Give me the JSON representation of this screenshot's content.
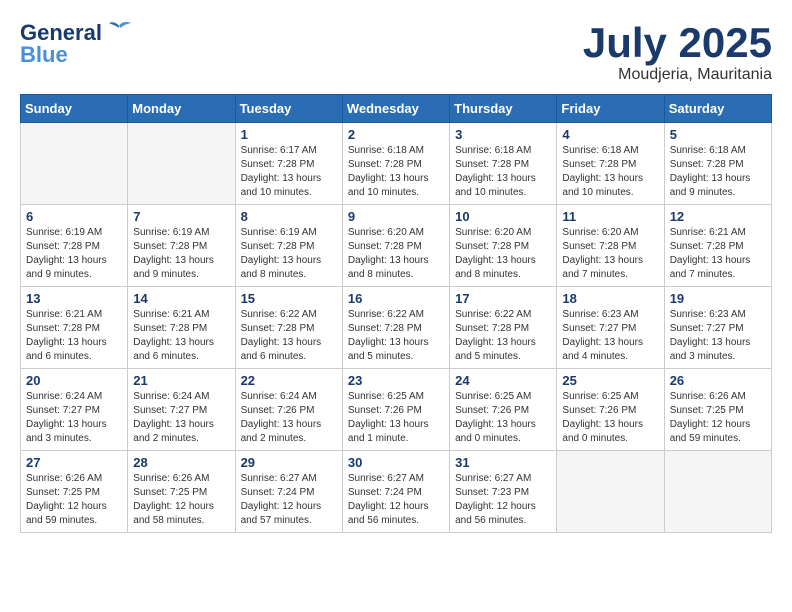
{
  "header": {
    "logo_general": "General",
    "logo_blue": "Blue",
    "month": "July 2025",
    "location": "Moudjeria, Mauritania"
  },
  "weekdays": [
    "Sunday",
    "Monday",
    "Tuesday",
    "Wednesday",
    "Thursday",
    "Friday",
    "Saturday"
  ],
  "weeks": [
    [
      {
        "day": "",
        "info": ""
      },
      {
        "day": "",
        "info": ""
      },
      {
        "day": "1",
        "info": "Sunrise: 6:17 AM\nSunset: 7:28 PM\nDaylight: 13 hours and 10 minutes."
      },
      {
        "day": "2",
        "info": "Sunrise: 6:18 AM\nSunset: 7:28 PM\nDaylight: 13 hours and 10 minutes."
      },
      {
        "day": "3",
        "info": "Sunrise: 6:18 AM\nSunset: 7:28 PM\nDaylight: 13 hours and 10 minutes."
      },
      {
        "day": "4",
        "info": "Sunrise: 6:18 AM\nSunset: 7:28 PM\nDaylight: 13 hours and 10 minutes."
      },
      {
        "day": "5",
        "info": "Sunrise: 6:18 AM\nSunset: 7:28 PM\nDaylight: 13 hours and 9 minutes."
      }
    ],
    [
      {
        "day": "6",
        "info": "Sunrise: 6:19 AM\nSunset: 7:28 PM\nDaylight: 13 hours and 9 minutes."
      },
      {
        "day": "7",
        "info": "Sunrise: 6:19 AM\nSunset: 7:28 PM\nDaylight: 13 hours and 9 minutes."
      },
      {
        "day": "8",
        "info": "Sunrise: 6:19 AM\nSunset: 7:28 PM\nDaylight: 13 hours and 8 minutes."
      },
      {
        "day": "9",
        "info": "Sunrise: 6:20 AM\nSunset: 7:28 PM\nDaylight: 13 hours and 8 minutes."
      },
      {
        "day": "10",
        "info": "Sunrise: 6:20 AM\nSunset: 7:28 PM\nDaylight: 13 hours and 8 minutes."
      },
      {
        "day": "11",
        "info": "Sunrise: 6:20 AM\nSunset: 7:28 PM\nDaylight: 13 hours and 7 minutes."
      },
      {
        "day": "12",
        "info": "Sunrise: 6:21 AM\nSunset: 7:28 PM\nDaylight: 13 hours and 7 minutes."
      }
    ],
    [
      {
        "day": "13",
        "info": "Sunrise: 6:21 AM\nSunset: 7:28 PM\nDaylight: 13 hours and 6 minutes."
      },
      {
        "day": "14",
        "info": "Sunrise: 6:21 AM\nSunset: 7:28 PM\nDaylight: 13 hours and 6 minutes."
      },
      {
        "day": "15",
        "info": "Sunrise: 6:22 AM\nSunset: 7:28 PM\nDaylight: 13 hours and 6 minutes."
      },
      {
        "day": "16",
        "info": "Sunrise: 6:22 AM\nSunset: 7:28 PM\nDaylight: 13 hours and 5 minutes."
      },
      {
        "day": "17",
        "info": "Sunrise: 6:22 AM\nSunset: 7:28 PM\nDaylight: 13 hours and 5 minutes."
      },
      {
        "day": "18",
        "info": "Sunrise: 6:23 AM\nSunset: 7:27 PM\nDaylight: 13 hours and 4 minutes."
      },
      {
        "day": "19",
        "info": "Sunrise: 6:23 AM\nSunset: 7:27 PM\nDaylight: 13 hours and 3 minutes."
      }
    ],
    [
      {
        "day": "20",
        "info": "Sunrise: 6:24 AM\nSunset: 7:27 PM\nDaylight: 13 hours and 3 minutes."
      },
      {
        "day": "21",
        "info": "Sunrise: 6:24 AM\nSunset: 7:27 PM\nDaylight: 13 hours and 2 minutes."
      },
      {
        "day": "22",
        "info": "Sunrise: 6:24 AM\nSunset: 7:26 PM\nDaylight: 13 hours and 2 minutes."
      },
      {
        "day": "23",
        "info": "Sunrise: 6:25 AM\nSunset: 7:26 PM\nDaylight: 13 hours and 1 minute."
      },
      {
        "day": "24",
        "info": "Sunrise: 6:25 AM\nSunset: 7:26 PM\nDaylight: 13 hours and 0 minutes."
      },
      {
        "day": "25",
        "info": "Sunrise: 6:25 AM\nSunset: 7:26 PM\nDaylight: 13 hours and 0 minutes."
      },
      {
        "day": "26",
        "info": "Sunrise: 6:26 AM\nSunset: 7:25 PM\nDaylight: 12 hours and 59 minutes."
      }
    ],
    [
      {
        "day": "27",
        "info": "Sunrise: 6:26 AM\nSunset: 7:25 PM\nDaylight: 12 hours and 59 minutes."
      },
      {
        "day": "28",
        "info": "Sunrise: 6:26 AM\nSunset: 7:25 PM\nDaylight: 12 hours and 58 minutes."
      },
      {
        "day": "29",
        "info": "Sunrise: 6:27 AM\nSunset: 7:24 PM\nDaylight: 12 hours and 57 minutes."
      },
      {
        "day": "30",
        "info": "Sunrise: 6:27 AM\nSunset: 7:24 PM\nDaylight: 12 hours and 56 minutes."
      },
      {
        "day": "31",
        "info": "Sunrise: 6:27 AM\nSunset: 7:23 PM\nDaylight: 12 hours and 56 minutes."
      },
      {
        "day": "",
        "info": ""
      },
      {
        "day": "",
        "info": ""
      }
    ]
  ]
}
